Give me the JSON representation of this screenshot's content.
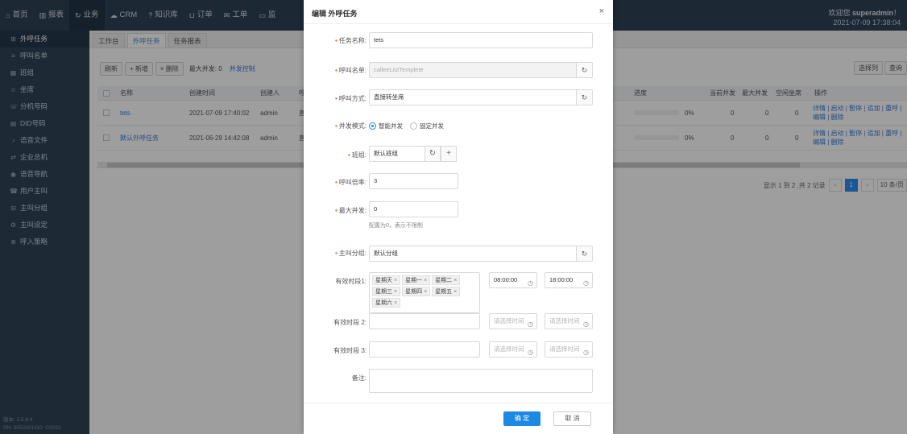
{
  "topbar": {
    "nav": [
      {
        "icon": "home-icon",
        "glyph": "⌂",
        "label": "首页"
      },
      {
        "icon": "chart-icon",
        "glyph": "▥",
        "label": "报表"
      },
      {
        "icon": "refresh-icon",
        "glyph": "↻",
        "label": "业务"
      },
      {
        "icon": "cloud-icon",
        "glyph": "☁",
        "label": "CRM"
      },
      {
        "icon": "question-icon",
        "glyph": "?",
        "label": "知识库"
      },
      {
        "icon": "cart-icon",
        "glyph": "⊔",
        "label": "订单"
      },
      {
        "icon": "mail-icon",
        "glyph": "✉",
        "label": "工单"
      },
      {
        "icon": "monitor-icon",
        "glyph": "▭",
        "label": "监"
      }
    ],
    "welcome_prefix": "欢迎您",
    "username": "superadmin",
    "welcome_suffix": "！",
    "datetime": "2021-07-09 17:38:04"
  },
  "sidebar": {
    "items": [
      {
        "icon": "grid-icon",
        "glyph": "⊞",
        "label": "外呼任务"
      },
      {
        "icon": "list-icon",
        "glyph": "≡",
        "label": "呼叫名单"
      },
      {
        "icon": "team-icon",
        "glyph": "▦",
        "label": "班组"
      },
      {
        "icon": "agent-icon",
        "glyph": "☺",
        "label": "坐席"
      },
      {
        "icon": "number-icon",
        "glyph": "☏",
        "label": "分机号码"
      },
      {
        "icon": "did-icon",
        "glyph": "▤",
        "label": "DID号码"
      },
      {
        "icon": "audio-icon",
        "glyph": "♪",
        "label": "语音文件"
      },
      {
        "icon": "switch-icon",
        "glyph": "⇄",
        "label": "企业总机"
      },
      {
        "icon": "nav-icon",
        "glyph": "◉",
        "label": "语音导航"
      },
      {
        "icon": "user-call-icon",
        "glyph": "☎",
        "label": "用户主叫"
      },
      {
        "icon": "group-icon",
        "glyph": "⊟",
        "label": "主叫分组"
      },
      {
        "icon": "setting-icon",
        "glyph": "⚙",
        "label": "主叫设定"
      },
      {
        "icon": "strategy-icon",
        "glyph": "⊕",
        "label": "呼入策略"
      }
    ],
    "version": "版本: 2.5.6.4",
    "serial": "SN: 2053301410",
    "year": "©2021"
  },
  "main": {
    "tabs": [
      "工作台",
      "外呼任务",
      "任务报表"
    ],
    "toolbar": {
      "refresh": "刷新",
      "add": "+ 新增",
      "delete": "× 删除",
      "max_concurrency": "最大并发: 0",
      "concurrency_control": "并发控制",
      "select_columns": "选择列",
      "query": "查询"
    },
    "columns": [
      "名称",
      "创建时间",
      "创建人",
      "呼",
      "进度",
      "当前并发",
      "最大并发",
      "空闲坐席",
      "操作"
    ],
    "rows": [
      {
        "name": "tets",
        "created": "2021-07-09 17:40:02",
        "creator": "admin",
        "col4": "直",
        "progress_text": "0%",
        "progress": 0,
        "current": "0",
        "max": "0",
        "idle": "0",
        "ops": "详情 | 启动 | 暂停 | 追加 | 重呼 | 编辑 | 删除"
      },
      {
        "name": "默认外呼任务",
        "created": "2021-06-29 14:42:08",
        "creator": "admin",
        "col4": "直",
        "progress_text": "0%",
        "progress": 0,
        "current": "0",
        "max": "0",
        "idle": "0",
        "ops": "详情 | 启动 | 暂停 | 追加 | 重呼 | 编辑 | 删除"
      }
    ],
    "pager": {
      "summary": "显示 1 到 2 ,共 2 记录",
      "prev": "‹",
      "current": "1",
      "next": "›",
      "page_size": "10 条/页"
    }
  },
  "modal": {
    "title": "编辑 外呼任务",
    "close": "×",
    "fields": {
      "task_name_label": "任务名称:",
      "task_name_value": "tets",
      "call_list_label": "呼叫名单:",
      "call_list_value": "calleeListTemplete",
      "call_mode_label": "呼叫方式:",
      "call_mode_value": "直接转坐席",
      "concurrency_mode_label": "并发模式:",
      "concurrency_options": [
        "智能并发",
        "固定并发"
      ],
      "team_label": "班组:",
      "team_value": "默认班组",
      "call_ratio_label": "呼叫倍率:",
      "call_ratio_value": "3",
      "max_concurrency_label": "最大并发:",
      "max_concurrency_value": "0",
      "max_concurrency_hint": "配置为0，表示不限制",
      "caller_group_label": "主叫分组:",
      "caller_group_value": "默认分组",
      "period1_label": "有效时段1:",
      "period1_days": [
        "星期天",
        "星期一",
        "星期二",
        "星期三",
        "星期四",
        "星期五",
        "星期六"
      ],
      "period1_start": "08:00:00",
      "period1_end": "18:00:00",
      "period2_label": "有效时段 2:",
      "period3_label": "有效时段 3:",
      "time_placeholder": "请选择时间",
      "remark_label": "备注:"
    },
    "ok": "确 定",
    "cancel": "取 消"
  },
  "colors": {
    "topbar": "#2f4256",
    "sidebar": "#304458",
    "accent": "#1e88e5",
    "required": "#e4572e"
  }
}
